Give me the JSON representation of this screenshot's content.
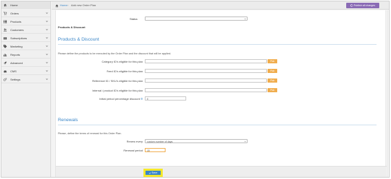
{
  "sidebar": {
    "items": [
      {
        "label": "Home",
        "icon": "home-icon",
        "has_chevron": false
      },
      {
        "label": "Orders",
        "icon": "cart-icon",
        "has_chevron": true
      },
      {
        "label": "Products",
        "icon": "list-icon",
        "has_chevron": true
      },
      {
        "label": "Customers",
        "icon": "users-icon",
        "has_chevron": true
      },
      {
        "label": "Subscriptions",
        "icon": "card-icon",
        "has_chevron": true
      },
      {
        "label": "Marketing",
        "icon": "tag-icon",
        "has_chevron": true
      },
      {
        "label": "Reports",
        "icon": "bar-chart-icon",
        "has_chevron": true
      },
      {
        "label": "Advanced",
        "icon": "rocket-icon",
        "has_chevron": true
      },
      {
        "label": "CMS",
        "icon": "car-icon",
        "has_chevron": true
      },
      {
        "label": "Settings",
        "icon": "gears-icon",
        "has_chevron": true
      }
    ]
  },
  "topbar": {
    "breadcrumb_home": "Home",
    "breadcrumb_separator": "›",
    "breadcrumb_current": "Add new Order Plan",
    "publish_label": "Publish all changes",
    "publish_color": "#8a6bb5"
  },
  "form": {
    "status_label": "Status",
    "status_value": "",
    "sub_heading": "Products & Discount",
    "products_section": {
      "title": "Products & Discount",
      "intro": "Please define the products to be executed by the Order Plan and the discount that will be applied.",
      "rows": [
        {
          "label": "Category ID's eligible for this plan",
          "value": "",
          "button": "Pick"
        },
        {
          "label": "Feed ID's eligible for this plan",
          "value": "",
          "button": "Pick"
        },
        {
          "label": "Reference ID / SKU's eligible for this plan",
          "value": "",
          "button": "Pick"
        },
        {
          "label": "Internal / product ID's eligible for this plan",
          "value": "",
          "button": "Pick"
        }
      ],
      "discount_label": "Initial period percentage discount",
      "discount_value": "0"
    },
    "renewals_section": {
      "title": "Renewals",
      "intro": "Please, define the terms of renewal for this Order Plan.",
      "renew_every_label": "Renew every",
      "renew_every_value": "custom number of days",
      "renewal_period_label": "Renewal period",
      "renewal_period_value": "15"
    }
  },
  "footer": {
    "save_label": "Save",
    "save_color": "#3a86c8",
    "highlight_color": "#f4e82b"
  }
}
